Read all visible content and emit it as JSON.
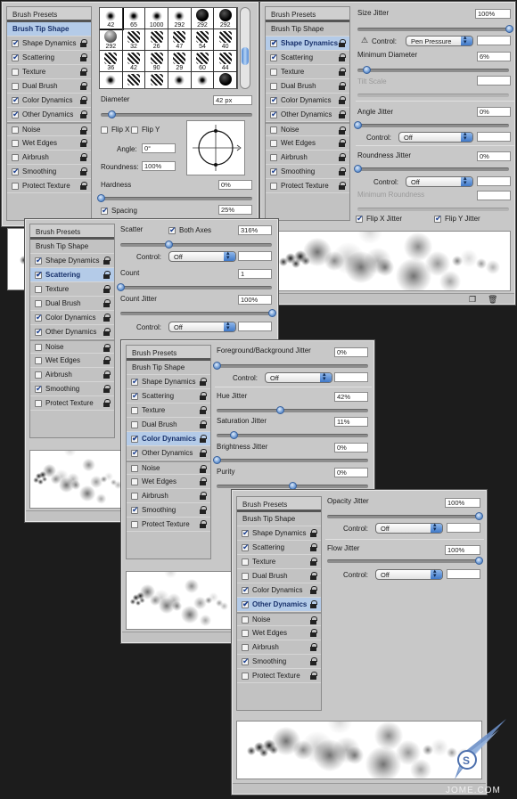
{
  "sidebar": {
    "presets": "Brush Presets",
    "tip_shape": "Brush Tip Shape",
    "items": [
      {
        "label": "Shape Dynamics",
        "checked": true
      },
      {
        "label": "Scattering",
        "checked": true
      },
      {
        "label": "Texture",
        "checked": false
      },
      {
        "label": "Dual Brush",
        "checked": false
      },
      {
        "label": "Color Dynamics",
        "checked": true
      },
      {
        "label": "Other Dynamics",
        "checked": true
      },
      {
        "label": "Noise",
        "checked": false
      },
      {
        "label": "Wet Edges",
        "checked": false
      },
      {
        "label": "Airbrush",
        "checked": false
      },
      {
        "label": "Smoothing",
        "checked": true
      },
      {
        "label": "Protect Texture",
        "checked": false
      }
    ]
  },
  "panel_tip": {
    "brush_sizes": [
      "42",
      "65",
      "1000",
      "292",
      "292",
      "292",
      "292",
      "32",
      "26",
      "47",
      "54",
      "40",
      "36",
      "42",
      "90",
      "29",
      "60",
      "44"
    ],
    "diameter_label": "Diameter",
    "diameter_value": "42 px",
    "diameter_slider": 0.07,
    "flip_x": "Flip X",
    "flip_y": "Flip Y",
    "angle_label": "Angle:",
    "angle_value": "0°",
    "roundness_label": "Roundness:",
    "roundness_value": "100%",
    "hardness_label": "Hardness",
    "hardness_value": "0%",
    "hardness_slider": 0.0,
    "spacing_label": "Spacing",
    "spacing_value": "25%",
    "spacing_checked": true
  },
  "panel_shape": {
    "size_jitter_label": "Size Jitter",
    "size_jitter_value": "100%",
    "size_jitter_slider": 1.0,
    "control_label": "Control:",
    "control_1": "Pen Pressure",
    "min_diameter_label": "Minimum Diameter",
    "min_diameter_value": "6%",
    "min_diameter_slider": 0.06,
    "tilt_scale_label": "Tilt Scale",
    "angle_jitter_label": "Angle Jitter",
    "angle_jitter_value": "0%",
    "control_2": "Off",
    "roundness_jitter_label": "Roundness Jitter",
    "roundness_jitter_value": "0%",
    "control_3": "Off",
    "min_roundness_label": "Minimum Roundness",
    "flip_x_jitter": "Flip X Jitter",
    "flip_y_jitter": "Flip Y Jitter"
  },
  "panel_scatter": {
    "scatter_label": "Scatter",
    "both_axes": "Both Axes",
    "scatter_value": "316%",
    "scatter_slider": 0.32,
    "control_label": "Control:",
    "control_1": "Off",
    "count_label": "Count",
    "count_value": "1",
    "count_slider": 0.0,
    "count_jitter_label": "Count Jitter",
    "count_jitter_value": "100%",
    "count_jitter_slider": 1.0,
    "control_2": "Off"
  },
  "panel_color": {
    "fg_bg_label": "Foreground/Background Jitter",
    "fg_bg_value": "0%",
    "fg_bg_slider": 0.0,
    "control_label": "Control:",
    "control_1": "Off",
    "hue_label": "Hue Jitter",
    "hue_value": "42%",
    "hue_slider": 0.42,
    "sat_label": "Saturation Jitter",
    "sat_value": "11%",
    "sat_slider": 0.11,
    "bright_label": "Brightness Jitter",
    "bright_value": "0%",
    "bright_slider": 0.0,
    "purity_label": "Purity",
    "purity_value": "0%",
    "purity_slider": 0.5
  },
  "panel_other": {
    "opacity_label": "Opacity Jitter",
    "opacity_value": "100%",
    "opacity_slider": 1.0,
    "control_label": "Control:",
    "control_1": "Off",
    "flow_label": "Flow Jitter",
    "flow_value": "100%",
    "flow_slider": 1.0,
    "control_2": "Off"
  },
  "watermark": {
    "text": "JOME.COM"
  }
}
